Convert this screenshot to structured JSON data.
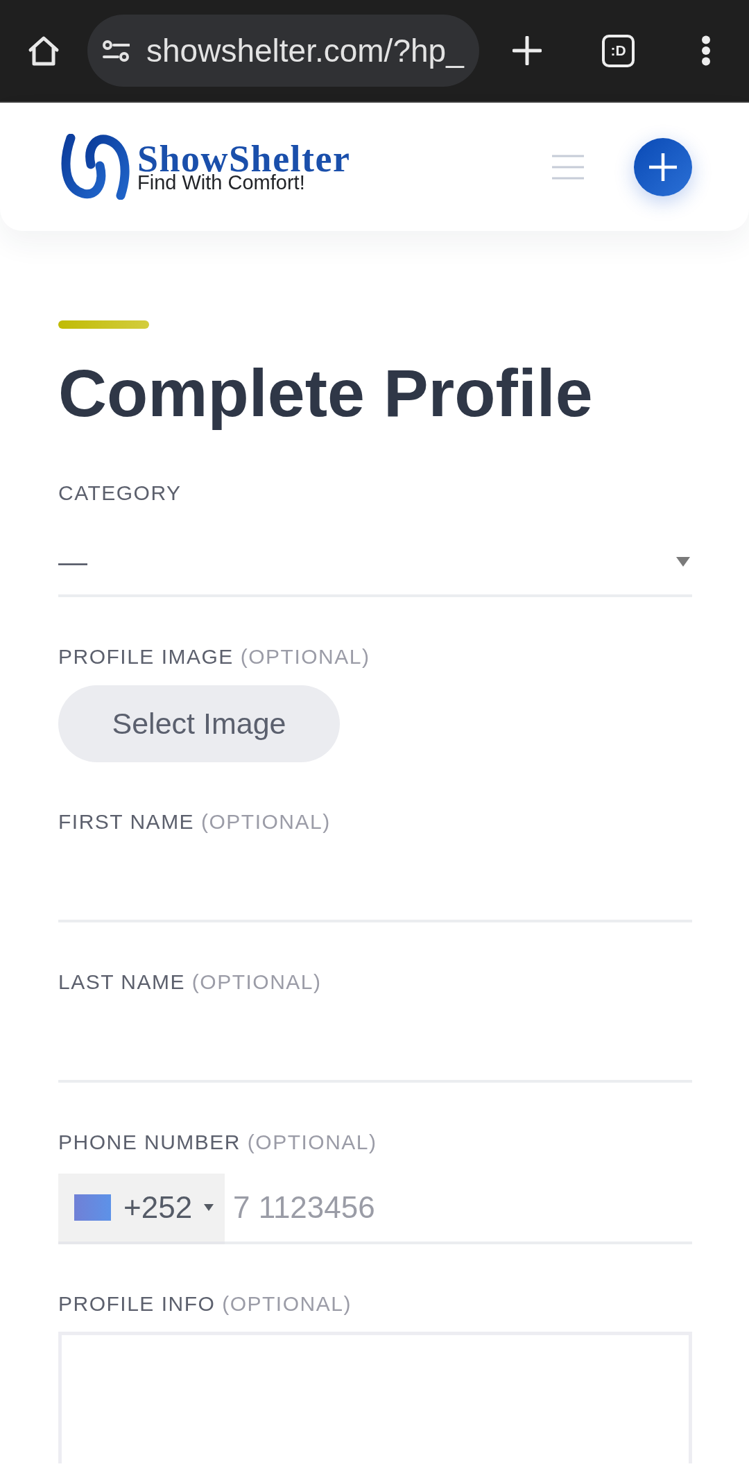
{
  "browser": {
    "url": "showshelter.com/?hp_",
    "tab_switcher_label": ":D"
  },
  "header": {
    "logo": {
      "name": "ShowShelter",
      "tagline": "Find With Comfort!"
    }
  },
  "page_title": "Complete Profile",
  "form": {
    "fields": [
      {
        "kind": "select",
        "label": "CATEGORY",
        "value": "—"
      },
      {
        "kind": "file",
        "label": "PROFILE IMAGE",
        "note": "(OPTIONAL)",
        "button": "Select Image"
      },
      {
        "kind": "text",
        "label": "FIRST NAME",
        "note": "(OPTIONAL)"
      },
      {
        "kind": "text",
        "label": "LAST NAME",
        "note": "(OPTIONAL)"
      },
      {
        "kind": "phone",
        "label": "PHONE NUMBER",
        "note": "(OPTIONAL)",
        "dial_code": "+252",
        "placeholder": "7 1123456"
      },
      {
        "kind": "textarea",
        "label": "PROFILE INFO",
        "note": "(OPTIONAL)"
      }
    ]
  }
}
